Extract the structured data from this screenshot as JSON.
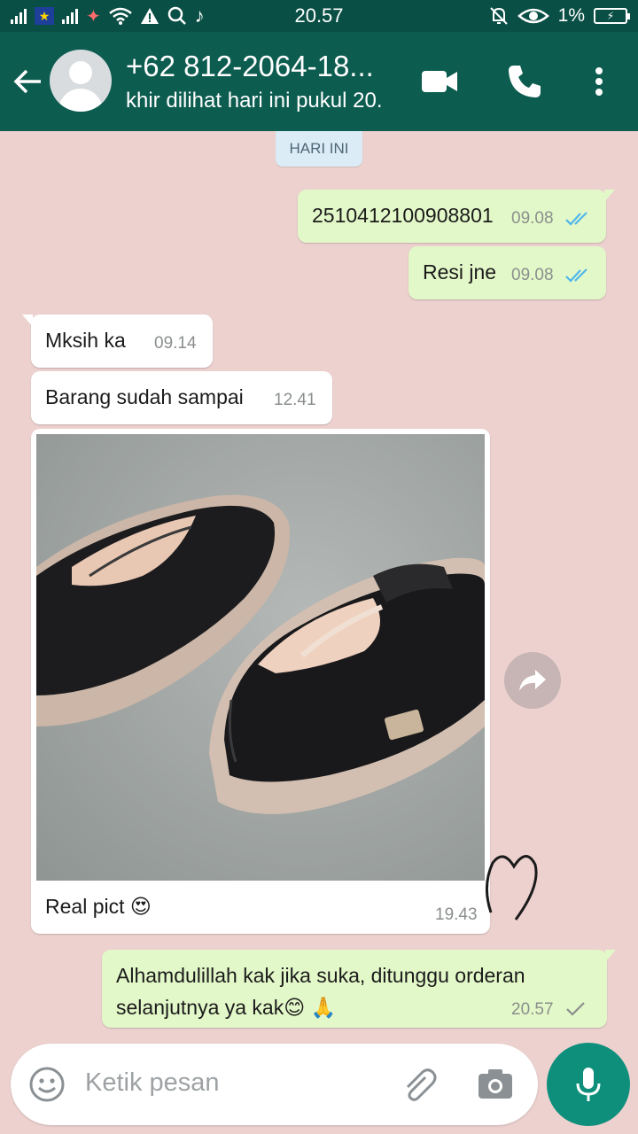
{
  "status_bar": {
    "time": "20.57",
    "battery": "1%"
  },
  "header": {
    "contact_name": "+62 812-2064-18...",
    "contact_status": "khir dilihat hari ini pukul 20."
  },
  "chat": {
    "date_chip": "HARI INI",
    "messages": [
      {
        "text": "2510412100908801",
        "time": "09.08",
        "direction": "out",
        "status": "read"
      },
      {
        "text": "Resi jne",
        "time": "09.08",
        "direction": "out",
        "status": "read"
      },
      {
        "text": "Mksih ka",
        "time": "09.14",
        "direction": "in"
      },
      {
        "text": "Barang sudah sampai",
        "time": "12.41",
        "direction": "in"
      },
      {
        "text": "Real pict 😍",
        "time": "19.43",
        "direction": "in",
        "has_image": true
      },
      {
        "text_line1": "Alhamdulillah kak jika suka, ditunggu orderan",
        "text_line2": "selanjutnya ya kak😊 🙏",
        "time": "20.57",
        "direction": "out",
        "status": "sent"
      }
    ]
  },
  "input": {
    "placeholder": "Ketik pesan"
  },
  "colors": {
    "header": "#0d5c50",
    "status_bar": "#0a4f45",
    "outgoing_bubble": "#e3f8c9",
    "incoming_bubble": "#ffffff",
    "read_tick": "#4fb6ec",
    "mic_button": "#0e8f7b",
    "wallpaper": "#ecd1cf"
  },
  "icons": [
    "back-arrow-icon",
    "video-call-icon",
    "voice-call-icon",
    "more-options-icon",
    "forward-icon",
    "emoji-icon",
    "attach-icon",
    "camera-icon",
    "mic-icon",
    "heart-doodle-icon"
  ]
}
